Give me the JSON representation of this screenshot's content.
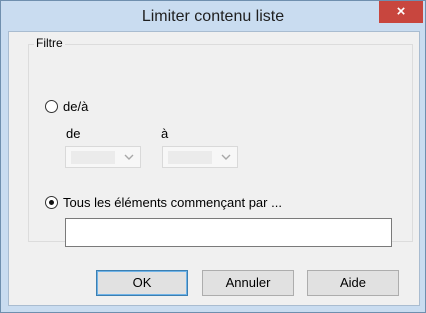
{
  "window": {
    "title": "Limiter contenu liste",
    "close_glyph": "×"
  },
  "filter": {
    "group_label": "Filtre",
    "range_option": {
      "label": "de/à",
      "selected": false,
      "from_label": "de",
      "to_label": "à",
      "from_value": "",
      "to_value": ""
    },
    "prefix_option": {
      "label": "Tous les éléments commençant par ...",
      "selected": true,
      "value": ""
    }
  },
  "buttons": {
    "ok": "OK",
    "cancel": "Annuler",
    "help": "Aide"
  },
  "icons": {
    "close": "close-icon",
    "dropdown": "chevron-down-icon"
  },
  "colors": {
    "title_bar": "#c9dcf0",
    "close_button": "#c8463e",
    "dialog_background": "#f0f0f0",
    "default_button_border": "#3c7fb1"
  }
}
